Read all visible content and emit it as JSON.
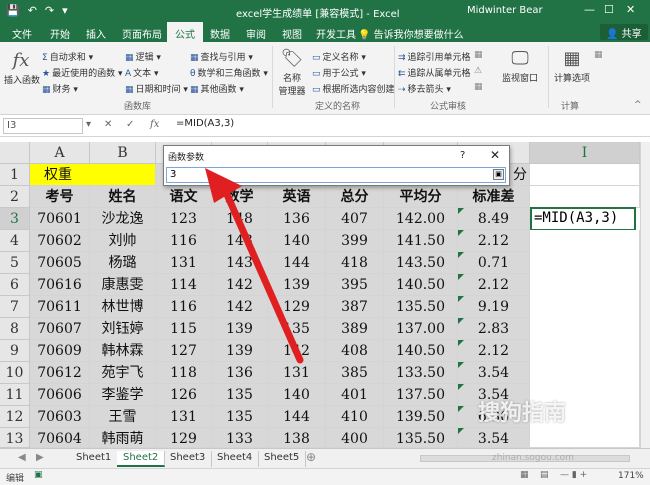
{
  "titlebar": {
    "title": "excel学生成绩单 [兼容模式] - Excel",
    "user": "Midwinter Bear",
    "minimize": "—",
    "restore": "☐",
    "close": "✕"
  },
  "tabs": [
    "文件",
    "开始",
    "插入",
    "页面布局",
    "公式",
    "数据",
    "审阅",
    "视图",
    "开发工具"
  ],
  "active_tab": "公式",
  "tell_me": "告诉我你想要做什么",
  "share": "共享",
  "ribbon": {
    "insert_function": "插入函数",
    "autosum": "自动求和",
    "recent": "最近使用的函数",
    "financial": "财务",
    "logical": "逻辑",
    "text": "文本",
    "datetime": "日期和时间",
    "lookup": "查找与引用",
    "math": "数学和三角函数",
    "more": "其他函数",
    "name_manager": "名称\n管理器",
    "name_manager_l1": "名称",
    "name_manager_l2": "管理器",
    "define_name": "定义名称",
    "use_in_formula": "用于公式",
    "create_from_sel": "根据所选内容创建",
    "trace_prec": "追踪引用单元格",
    "trace_dep": "追踪从属单元格",
    "remove_arrows": "移去箭头",
    "watch": "监视窗口",
    "calc_options": "计算选项",
    "group_library": "函数库",
    "group_names": "定义的名称",
    "group_audit": "公式审核",
    "group_calc": "计算"
  },
  "formula_bar": {
    "name_box": "I3",
    "fx": "fx",
    "cancel": "✕",
    "enter": "✓",
    "formula": "=MID(A3,3)"
  },
  "columns": [
    "A",
    "B",
    "C",
    "D",
    "E",
    "F",
    "G",
    "H",
    "I"
  ],
  "rows": [
    "1",
    "2",
    "3",
    "4",
    "5",
    "6",
    "7",
    "8",
    "9",
    "10",
    "11",
    "12",
    "13"
  ],
  "sheet": {
    "weight_label": "权重",
    "h_partial": "分",
    "headers": [
      "考号",
      "姓名",
      "语文",
      "数学",
      "英语",
      "总分",
      "平均分",
      "标准差"
    ],
    "data": [
      [
        "70601",
        "沙龙逸",
        "123",
        "148",
        "136",
        "407",
        "142.00",
        "8.49"
      ],
      [
        "70602",
        "刘帅",
        "116",
        "143",
        "140",
        "399",
        "141.50",
        "2.12"
      ],
      [
        "70605",
        "杨璐",
        "131",
        "143",
        "144",
        "418",
        "143.50",
        "0.71"
      ],
      [
        "70616",
        "康惠雯",
        "114",
        "142",
        "139",
        "395",
        "140.50",
        "2.12"
      ],
      [
        "70611",
        "林世博",
        "116",
        "142",
        "129",
        "387",
        "135.50",
        "9.19"
      ],
      [
        "70607",
        "刘钰婷",
        "115",
        "139",
        "135",
        "389",
        "137.00",
        "2.83"
      ],
      [
        "70609",
        "韩林霖",
        "127",
        "139",
        "142",
        "408",
        "140.50",
        "2.12"
      ],
      [
        "70612",
        "苑宇飞",
        "118",
        "136",
        "131",
        "385",
        "133.50",
        "3.54"
      ],
      [
        "70606",
        "李鉴学",
        "126",
        "135",
        "140",
        "401",
        "137.50",
        "3.54"
      ],
      [
        "70603",
        "王雪",
        "131",
        "135",
        "144",
        "410",
        "139.50",
        "6.36"
      ],
      [
        "70604",
        "韩雨萌",
        "129",
        "133",
        "138",
        "400",
        "135.50",
        "3.54"
      ]
    ],
    "active_cell_text": "=MID(A3,3)"
  },
  "dialog": {
    "title": "函数参数",
    "help": "?",
    "close": "✕",
    "input_value": "3",
    "collapse": "▣"
  },
  "sheet_tabs": [
    "Sheet1",
    "Sheet2",
    "Sheet3",
    "Sheet4",
    "Sheet5"
  ],
  "active_sheet": "Sheet2",
  "status": {
    "mode": "编辑",
    "zoom": "171%"
  },
  "watermark": {
    "text": "搜狗指南",
    "url": "zhinan.sogou.com"
  },
  "colors": {
    "excel_green": "#217346",
    "highlight_yellow": "#ffff00",
    "arrow_red": "#e02020"
  }
}
